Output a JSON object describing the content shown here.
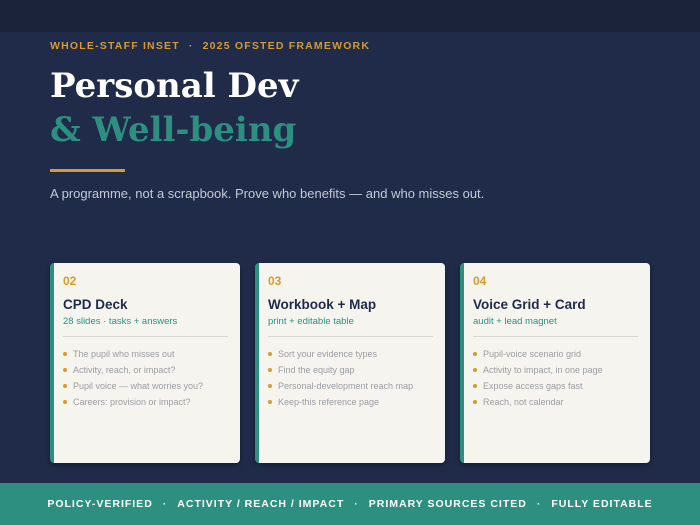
{
  "eyebrow": {
    "left": "WHOLE-STAFF INSET",
    "separator": "·",
    "right": "2025 OFSTED FRAMEWORK"
  },
  "title": {
    "line1": "Personal Dev",
    "line2": "& Well-being"
  },
  "tagline": "A programme, not a scrapbook. Prove who benefits — and who misses out.",
  "cards": [
    {
      "number": "02",
      "name": "CPD Deck",
      "subtitle": "28 slides · tasks + answers",
      "items": [
        "The pupil who misses out",
        "Activity, reach, or impact?",
        "Pupil voice — what worries you?",
        "Careers: provision or impact?"
      ]
    },
    {
      "number": "03",
      "name": "Workbook + Map",
      "subtitle": "print + editable table",
      "items": [
        "Sort your evidence types",
        "Find the equity gap",
        "Personal-development reach map",
        "Keep-this reference page"
      ]
    },
    {
      "number": "04",
      "name": "Voice Grid + Card",
      "subtitle": "audit + lead magnet",
      "items": [
        "Pupil-voice scenario grid",
        "Activity to impact, in one page",
        "Expose access gaps fast",
        "Reach, not calendar"
      ]
    }
  ],
  "footer": {
    "separator": "·",
    "items": [
      "POLICY-VERIFIED",
      "ACTIVITY / REACH / IMPACT",
      "PRIMARY SOURCES CITED",
      "FULLY EDITABLE"
    ]
  },
  "colors": {
    "background": "#1f2b49",
    "accent_gold": "#d79a2b",
    "accent_teal": "#2c8f80",
    "card": "#f6f4ef"
  }
}
